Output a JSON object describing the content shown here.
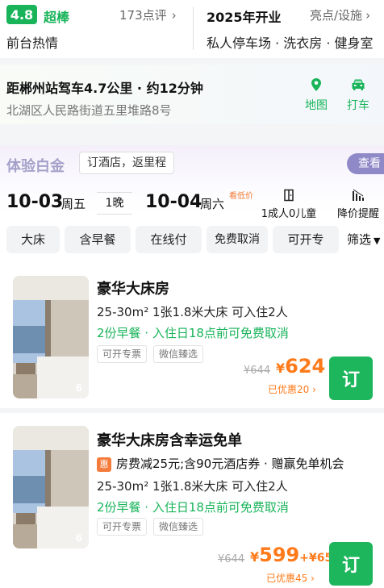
{
  "header": {
    "score": "4.8",
    "rating_word": "超棒",
    "reviews": "173点评",
    "front_desk": "前台热情",
    "opened": "2025年开业",
    "highlights": "亮点/设施",
    "facilities": "私人停车场 · 洗衣房 · 健身室"
  },
  "location": {
    "distance": "距郴州站驾车4.7公里 · 约12分钟",
    "address": "北湖区人民路街道五里堆路8号",
    "map_label": "地图",
    "taxi_label": "打车"
  },
  "membership": {
    "title": "体验白金",
    "tag": "订酒店，返里程",
    "view_label": "查看"
  },
  "dates": {
    "checkin_date": "10-03",
    "checkin_weekday": "周五",
    "nights": "1晚",
    "checkout_date": "10-04",
    "checkout_weekday": "周六",
    "night_price_label": "看低价",
    "guests": "1成人0儿童",
    "price_alert": "降价提醒"
  },
  "filters": {
    "chips": [
      "大床",
      "含早餐",
      "在线付",
      "免费取消",
      "可开专"
    ],
    "filter_label": "筛选"
  },
  "rooms": [
    {
      "name": "豪华大床房",
      "specs": "25-30m² 1张1.8米大床 可入住2人",
      "policy": "2份早餐 · 入住日18点前可免费取消",
      "tags": [
        "可开专票",
        "微信臻选"
      ],
      "photo_count": "6",
      "original_price": "¥644",
      "currency": "¥",
      "price": "624",
      "saved": "已优惠20",
      "book_label": "订"
    },
    {
      "name": "豪华大床房含幸运免单",
      "promo_badge": "惠",
      "promo": "房费减25元;含90元酒店券 · 赠赢免单机会",
      "specs": "25-30m² 1张1.8米大床 可入住2人",
      "policy": "2份早餐 · 入住日18点前可免费取消",
      "tags": [
        "可开专票",
        "微信臻选"
      ],
      "photo_count": "6",
      "original_price": "¥644",
      "currency": "¥",
      "price": "599",
      "price_extra": "+¥65",
      "saved": "已优惠45",
      "book_label": "订"
    }
  ],
  "colors": {
    "brand_green": "#1db65c",
    "price_orange": "#ff7a1a",
    "vip_purple": "#8f89c7"
  }
}
